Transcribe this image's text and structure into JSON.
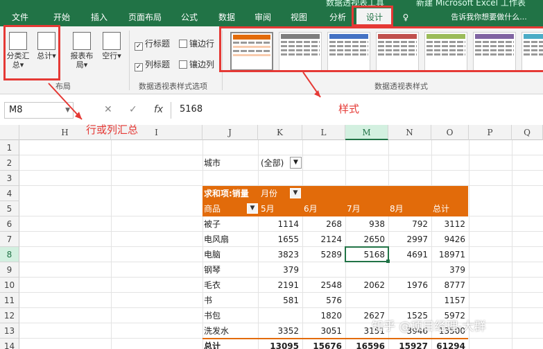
{
  "tabs": [
    "文件",
    "开始",
    "插入",
    "页面布局",
    "公式",
    "数据",
    "审阅",
    "视图",
    "分析",
    "设计",
    "♀",
    "告诉我你想要做什么..."
  ],
  "title_fragment": "数据透视表工具",
  "title_right": "新建 Microsoft Excel 工作表",
  "ribbon": {
    "layout_buttons": [
      "分类汇总",
      "总计",
      "报表布局",
      "空行"
    ],
    "layout_group": "布局",
    "options": {
      "row_headers": "行标题",
      "col_headers": "列标题",
      "banded_rows": "镶边行",
      "banded_cols": "镶边列"
    },
    "options_group": "数据透视表样式选项",
    "styles_group": "数据透视表样式"
  },
  "formula_bar": {
    "name_box": "M8",
    "fx": "fx",
    "value": "5168"
  },
  "annotations": {
    "row_col_total": "行或列汇总",
    "style": "样式"
  },
  "columns": [
    "H",
    "I",
    "J",
    "K",
    "L",
    "M",
    "N",
    "O",
    "P",
    "Q"
  ],
  "rows": [
    "1",
    "2",
    "3",
    "4",
    "5",
    "6",
    "7",
    "8",
    "9",
    "10",
    "11",
    "12",
    "13",
    "14"
  ],
  "filter": {
    "label": "城市",
    "value": "(全部)"
  },
  "pivot": {
    "header_label": "求和项:销量",
    "col_field": "月份",
    "row_field": "商品",
    "months": [
      "5月",
      "6月",
      "7月",
      "8月",
      "总计"
    ],
    "rows": [
      {
        "name": "被子",
        "vals": [
          "1114",
          "268",
          "938",
          "792",
          "3112"
        ]
      },
      {
        "name": "电风扇",
        "vals": [
          "1655",
          "2124",
          "2650",
          "2997",
          "9426"
        ]
      },
      {
        "name": "电脑",
        "vals": [
          "3823",
          "5289",
          "5168",
          "4691",
          "18971"
        ]
      },
      {
        "name": "钢琴",
        "vals": [
          "379",
          "",
          "",
          "",
          "379"
        ]
      },
      {
        "name": "毛衣",
        "vals": [
          "2191",
          "2548",
          "2062",
          "1976",
          "8777"
        ]
      },
      {
        "name": "书",
        "vals": [
          "581",
          "576",
          "",
          "",
          "1157"
        ]
      },
      {
        "name": "书包",
        "vals": [
          "",
          "1820",
          "2627",
          "1525",
          "5972"
        ]
      },
      {
        "name": "洗发水",
        "vals": [
          "3352",
          "3051",
          "3151",
          "3946",
          "13500"
        ]
      }
    ],
    "total": {
      "name": "总计",
      "vals": [
        "13095",
        "15676",
        "16596",
        "15927",
        "61294"
      ]
    }
  },
  "watermark": "知乎 @项目经理-大群",
  "colors": {
    "accent": "#217346",
    "pivot_header": "#e26b0a",
    "annotation": "#e53935"
  }
}
